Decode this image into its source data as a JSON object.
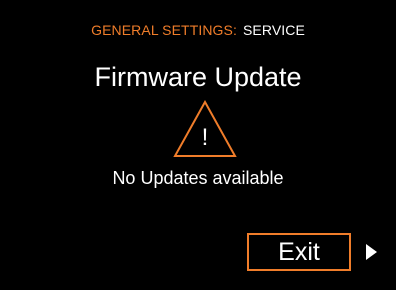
{
  "header": {
    "section": "GENERAL SETTINGS:",
    "subsection": "SERVICE"
  },
  "title": "Firmware Update",
  "warning": {
    "icon": "warning-triangle-icon",
    "glyph": "!"
  },
  "status": "No Updates available",
  "exit_label": "Exit",
  "next_icon": "chevron-right-icon",
  "colors": {
    "accent": "#f07d2a",
    "text": "#ffffff",
    "background": "#000000"
  }
}
